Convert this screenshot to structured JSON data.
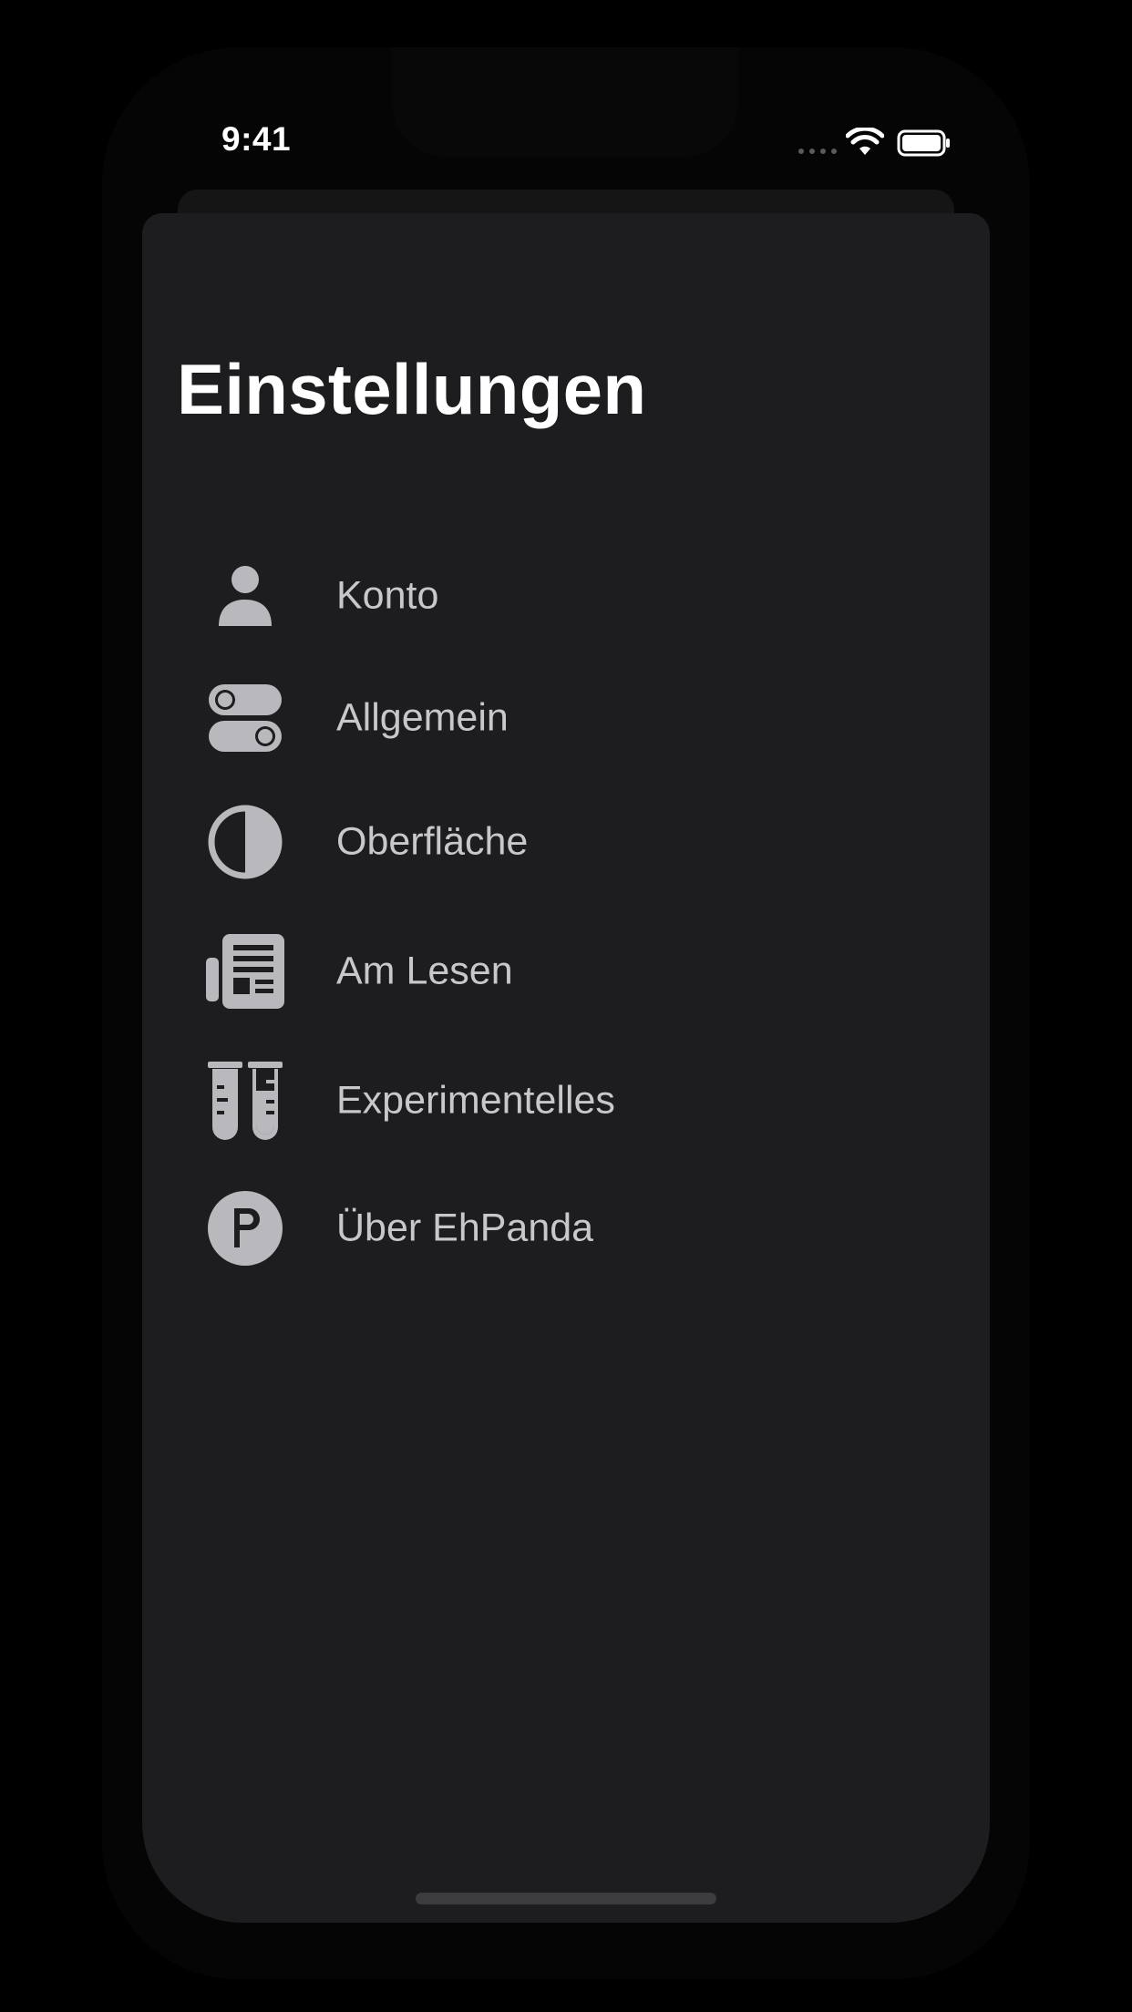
{
  "status_bar": {
    "time": "9:41",
    "wifi_icon": "wifi-icon",
    "battery_icon": "battery-icon"
  },
  "page": {
    "title": "Einstellungen"
  },
  "menu": {
    "items": [
      {
        "label": "Konto",
        "icon": "person-icon"
      },
      {
        "label": "Allgemein",
        "icon": "switches-icon"
      },
      {
        "label": "Oberfläche",
        "icon": "circle-half-icon"
      },
      {
        "label": "Am Lesen",
        "icon": "newspaper-icon"
      },
      {
        "label": "Experimentelles",
        "icon": "test-tubes-icon"
      },
      {
        "label": "Über EhPanda",
        "icon": "p-circle-icon"
      }
    ]
  },
  "colors": {
    "background": "#000000",
    "sheet": "#1d1d1f",
    "title": "#ffffff",
    "label": "#c7c7cc",
    "icon": "#b9b9bd"
  }
}
